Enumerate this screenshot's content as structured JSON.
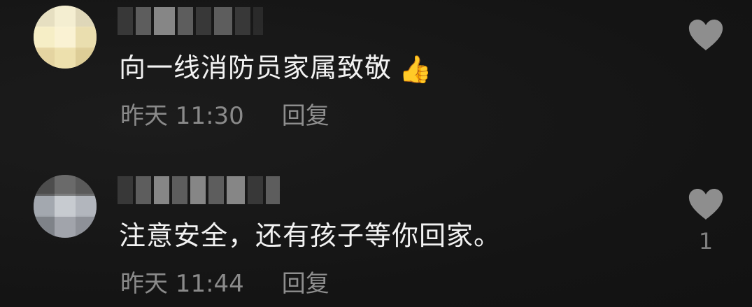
{
  "comments": [
    {
      "text": "向一线消防员家属致敬",
      "emoji": "👍",
      "time": "昨天 11:30",
      "reply_label": "回复",
      "like_icon": "heart-icon",
      "like_count": ""
    },
    {
      "text": "注意安全，还有孩子等你回家。",
      "time": "昨天 11:44",
      "reply_label": "回复",
      "like_icon": "heart-icon",
      "like_count": "1"
    }
  ],
  "colors": {
    "background": "#161616",
    "text": "#f2f2f2",
    "meta": "#8a8a8a",
    "heart": "#8e8e8e"
  }
}
